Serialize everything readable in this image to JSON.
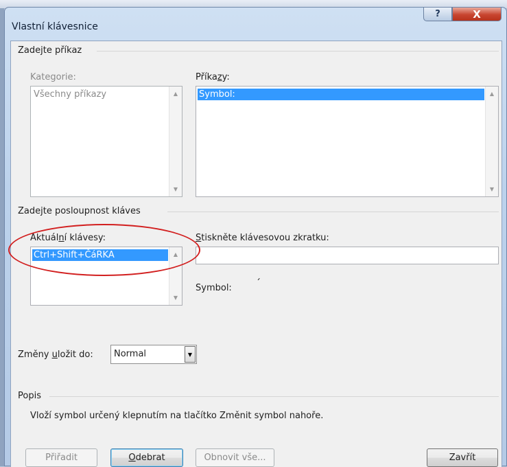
{
  "window": {
    "title": "Vlastní klávesnice",
    "help_label": "?",
    "close_label": "X"
  },
  "command_group": {
    "title": "Zadejte příkaz",
    "categories_label_prefix": "Kategorie:",
    "categories": [
      "Všechny příkazy"
    ],
    "commands_label_pre": "Příka",
    "commands_label_key": "z",
    "commands_label_post": "y:",
    "commands": [
      "Symbol:"
    ]
  },
  "keys_group": {
    "title": "Zadejte posloupnost kláves",
    "current_label_pre": "Aktuál",
    "current_label_key": "n",
    "current_label_post": "í klávesy:",
    "current_keys": [
      "Ctrl+Shift+ČáRKA"
    ],
    "press_label_key": "S",
    "press_label_post": "tiskněte klávesovou zkratku:",
    "press_value": "",
    "symbol_label": "Symbol:",
    "symbol_value": "´"
  },
  "save_in": {
    "label_pre": "Změny ",
    "label_key": "u",
    "label_post": "ložit do:",
    "value": "Normal"
  },
  "description": {
    "title": "Popis",
    "text": "Vloží symbol určený klepnutím na tlačítko Změnit symbol nahoře."
  },
  "buttons": {
    "assign": "Přiřadit",
    "remove_key": "O",
    "remove_post": "debrat",
    "reset": "Obnovit vše...",
    "close": "Zavřít"
  },
  "colors": {
    "selection": "#3399ff",
    "annotation": "#d21f1f"
  }
}
